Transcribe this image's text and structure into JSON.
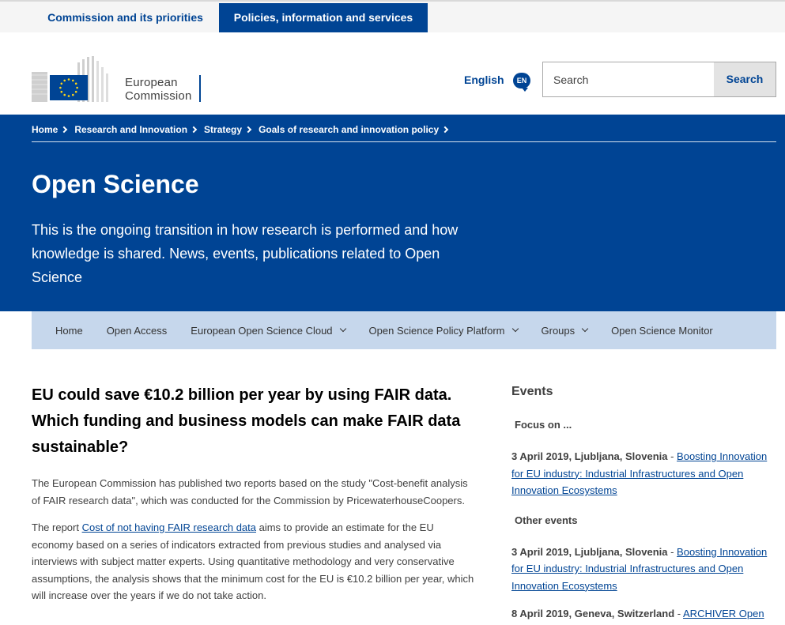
{
  "topnav": {
    "tabs": [
      {
        "label": "Commission and its priorities"
      },
      {
        "label": "Policies, information and services"
      }
    ]
  },
  "header": {
    "logo_line1": "European",
    "logo_line2": "Commission",
    "language": "English",
    "language_code": "EN",
    "search_placeholder": "Search",
    "search_button": "Search"
  },
  "breadcrumb": [
    {
      "label": "Home"
    },
    {
      "label": "Research and Innovation"
    },
    {
      "label": "Strategy"
    },
    {
      "label": "Goals of research and innovation policy"
    }
  ],
  "page": {
    "title": "Open Science",
    "intro": "This is the ongoing transition in how research is performed and how knowledge is shared. News, events, publications related to Open Science"
  },
  "subnav": [
    {
      "label": "Home"
    },
    {
      "label": "Open Access"
    },
    {
      "label": "European Open Science Cloud"
    },
    {
      "label": "Open Science Policy Platform"
    },
    {
      "label": "Groups"
    },
    {
      "label": "Open Science Monitor"
    }
  ],
  "article": {
    "headline": "EU could save €10.2 billion per year by using FAIR data. Which funding and business models can make FAIR data sustainable?",
    "p1": "The European Commission has published two reports based on the study \"Cost-benefit analysis of FAIR research data\", which was conducted for the Commission by PricewaterhouseCoopers.",
    "p2_prefix": "The report ",
    "p2_link": "Cost of not having FAIR research data",
    "p2_suffix": " aims to provide an estimate for the EU economy based on a series of indicators extracted from previous studies and analysed via interviews with subject matter experts. Using quantitative methodology and very conservative assumptions, the analysis shows that the minimum cost for the EU is €10.2 billion per year, which will increase over the years if we do not take action."
  },
  "sidebar": {
    "title": "Events",
    "focus_heading": "Focus on ...",
    "other_heading": "Other events",
    "events": [
      {
        "meta": "3 April 2019, Ljubljana, Slovenia",
        "sep": " - ",
        "link": "Boosting Innovation for EU industry: Industrial Infrastructures and Open Innovation Ecosystems"
      },
      {
        "meta": "3 April 2019, Ljubljana, Slovenia",
        "sep": " - ",
        "link": "Boosting Innovation for EU industry: Industrial Infrastructures and Open Innovation Ecosystems"
      },
      {
        "meta": "8 April 2019, Geneva, Switzerland",
        "sep": " - ",
        "link": "ARCHIVER Open"
      }
    ]
  },
  "colors": {
    "brand_blue": "#004494",
    "subnav_bg": "#c6d7ec",
    "eu_yellow": "#ffd617"
  }
}
